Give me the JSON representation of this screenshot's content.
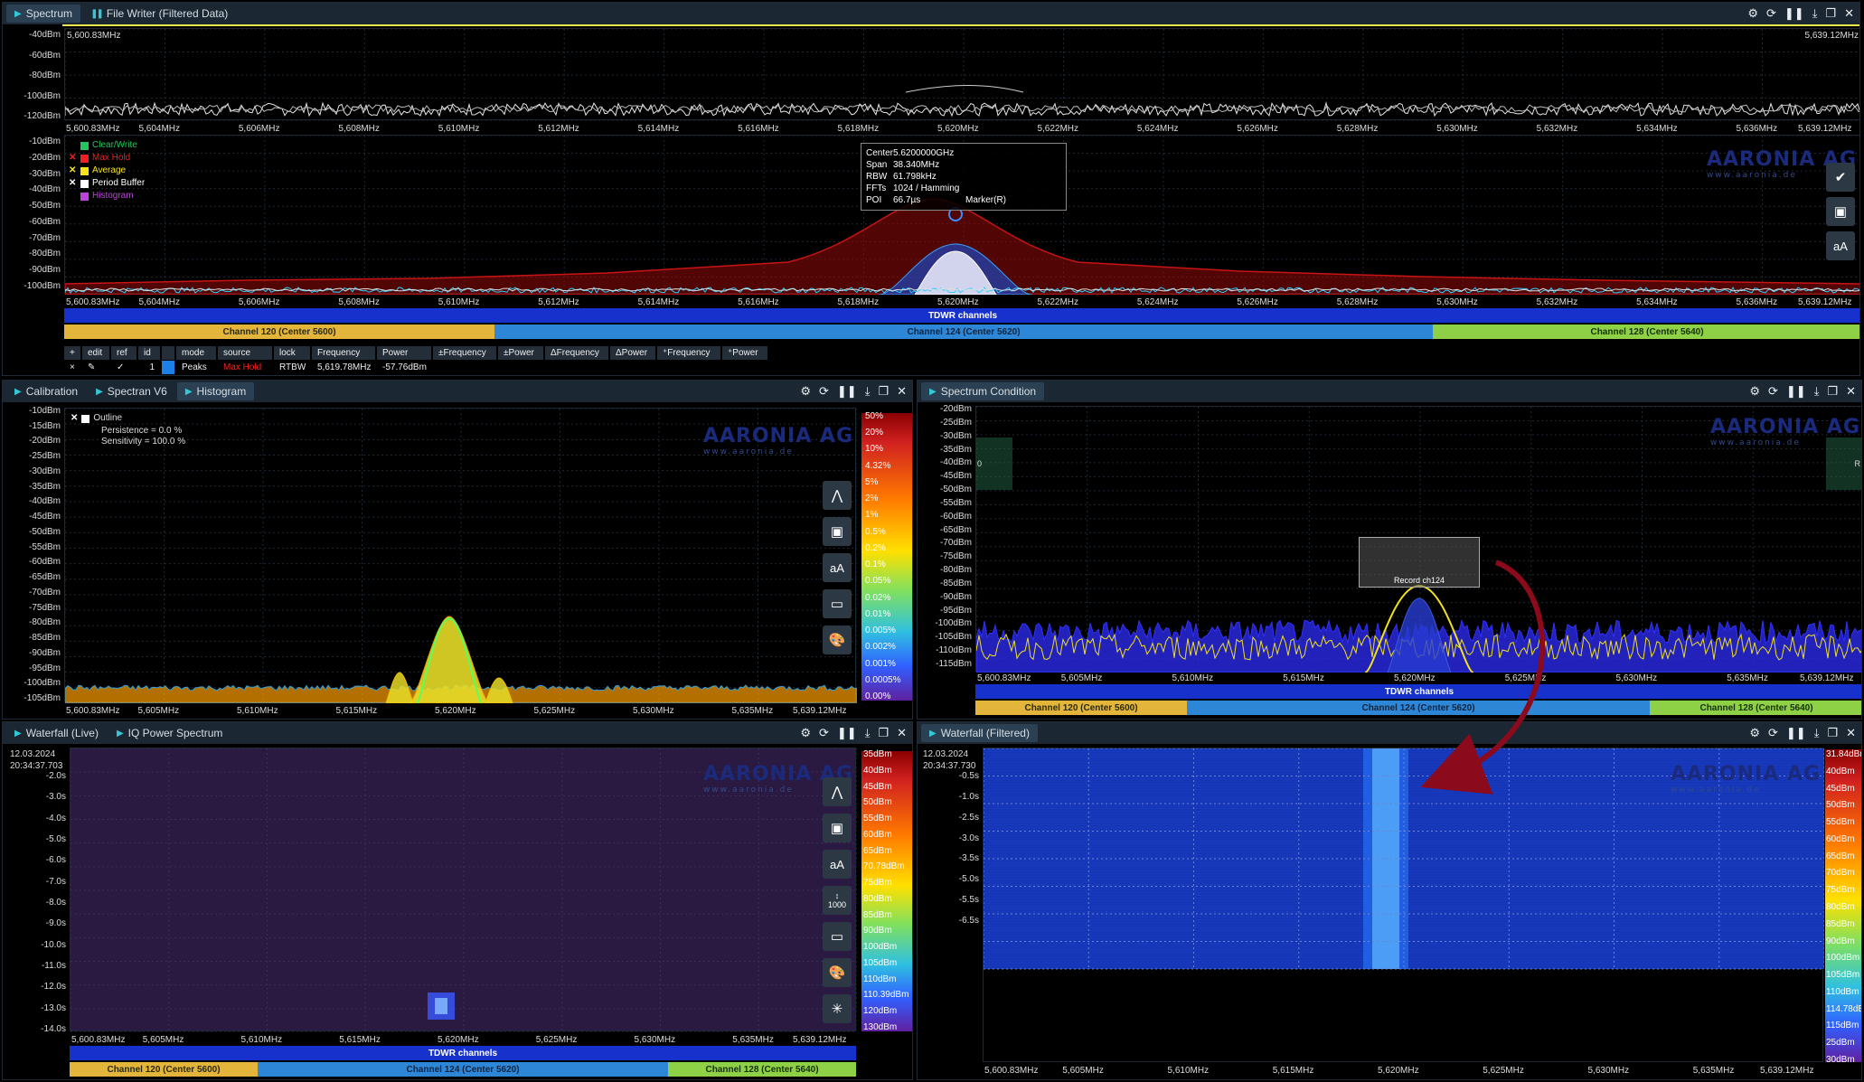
{
  "top": {
    "tabs": [
      {
        "label": "Spectrum"
      },
      {
        "label": "File Writer (Filtered Data)"
      }
    ],
    "overview": {
      "freq_left": "5,600.83MHz",
      "freq_right": "5,639.12MHz",
      "y_labels": [
        "-40dBm",
        "-60dBm",
        "-80dBm",
        "-100dBm",
        "-120dBm"
      ],
      "x_labels": [
        "5,600.83MHz",
        "5,604MHz",
        "5,606MHz",
        "5,608MHz",
        "5,610MHz",
        "5,612MHz",
        "5,614MHz",
        "5,616MHz",
        "5,618MHz",
        "5,620MHz",
        "5,622MHz",
        "5,624MHz",
        "5,626MHz",
        "5,628MHz",
        "5,630MHz",
        "5,632MHz",
        "5,634MHz",
        "5,636MHz",
        "5,639.12MHz"
      ]
    },
    "main": {
      "y_labels": [
        "-10dBm",
        "-20dBm",
        "-30dBm",
        "-40dBm",
        "-50dBm",
        "-60dBm",
        "-70dBm",
        "-80dBm",
        "-90dBm",
        "-100dBm"
      ],
      "x_labels": [
        "5,600.83MHz",
        "5,604MHz",
        "5,606MHz",
        "5,608MHz",
        "5,610MHz",
        "5,612MHz",
        "5,614MHz",
        "5,616MHz",
        "5,618MHz",
        "5,620MHz",
        "5,622MHz",
        "5,624MHz",
        "5,626MHz",
        "5,628MHz",
        "5,630MHz",
        "5,632MHz",
        "5,634MHz",
        "5,636MHz",
        "5,639.12MHz"
      ],
      "legend": [
        {
          "label": "Clear/Write",
          "color": "#22c55e"
        },
        {
          "label": "Max Hold",
          "color": "#ef2020"
        },
        {
          "label": "Average",
          "color": "#f5e21a"
        },
        {
          "label": "Period Buffer",
          "color": "#ffffff"
        },
        {
          "label": "Histogram",
          "color": "#c040e0"
        }
      ],
      "tooltip": {
        "center_k": "Center",
        "center": "5.6200000GHz",
        "span_k": "Span",
        "span": "38.340MHz",
        "rbw_k": "RBW",
        "rbw": "61.798kHz",
        "ffts_k": "FFTs",
        "ffts": "1024 / Hamming",
        "poi_k": "POI",
        "poi": "66.7µs",
        "marker": "Marker(R)"
      }
    },
    "channels": {
      "tdwr": "TDWR channels",
      "ch120": "Channel 120 (Center 5600)",
      "ch124": "Channel 124 (Center 5620)",
      "ch128": "Channel 128 (Center 5640)"
    },
    "marker_table": {
      "headers": [
        "+",
        "edit",
        "ref",
        "id",
        "",
        "mode",
        "source",
        "lock",
        "Frequency",
        "Power",
        "±Frequency",
        "±Power",
        "ΔFrequency",
        "ΔPower",
        "⁺Frequency",
        "⁺Power"
      ],
      "row": {
        "x": "×",
        "edit": "✎",
        "ref": "✓",
        "id": "1",
        "mode": "Peaks",
        "source": "Max Hold",
        "lock": "RTBW",
        "freq": "5,619.78MHz",
        "power": "-57.76dBm"
      }
    },
    "watermark": "AARONIA AG",
    "watermark_sub": "www.aaronia.de"
  },
  "calib": {
    "tabs": [
      {
        "label": "Calibration"
      },
      {
        "label": "Spectran V6"
      },
      {
        "label": "Histogram"
      }
    ],
    "y_labels": [
      "-10dBm",
      "-15dBm",
      "-20dBm",
      "-25dBm",
      "-30dBm",
      "-35dBm",
      "-40dBm",
      "-45dBm",
      "-50dBm",
      "-55dBm",
      "-60dBm",
      "-65dBm",
      "-70dBm",
      "-75dBm",
      "-80dBm",
      "-85dBm",
      "-90dBm",
      "-95dBm",
      "-100dBm",
      "-105dBm"
    ],
    "x_labels": [
      "5,600.83MHz",
      "5,605MHz",
      "5,610MHz",
      "5,615MHz",
      "5,620MHz",
      "5,625MHz",
      "5,630MHz",
      "5,635MHz",
      "5,639.12MHz"
    ],
    "outline": "Outline",
    "persistence": "Persistence = 0.0 %",
    "sensitivity": "Sensitivity = 100.0 %",
    "scale": [
      "50%",
      "20%",
      "10%",
      "4.32%",
      "5%",
      "2%",
      "1%",
      "0.5%",
      "0.2%",
      "0.1%",
      "0.05%",
      "0.02%",
      "0.01%",
      "0.005%",
      "0.002%",
      "0.001%",
      "0.0005%",
      "0.00%"
    ]
  },
  "cond": {
    "tabs": [
      {
        "label": "Spectrum Condition"
      }
    ],
    "y_labels": [
      "-20dBm",
      "-25dBm",
      "-30dBm",
      "-35dBm",
      "-40dBm",
      "-45dBm",
      "-50dBm",
      "-55dBm",
      "-60dBm",
      "-65dBm",
      "-70dBm",
      "-75dBm",
      "-80dBm",
      "-85dBm",
      "-90dBm",
      "-95dBm",
      "-100dBm",
      "-105dBm",
      "-110dBm",
      "-115dBm"
    ],
    "x_labels": [
      "5,600.83MHz",
      "5,605MHz",
      "5,610MHz",
      "5,615MHz",
      "5,620MHz",
      "5,625MHz",
      "5,630MHz",
      "5,635MHz",
      "5,639.12MHz"
    ],
    "record_label": "Record ch124",
    "left_marker": "0",
    "right_marker": "R"
  },
  "wf_live": {
    "tabs": [
      {
        "label": "Waterfall (Live)"
      },
      {
        "label": "IQ Power Spectrum"
      }
    ],
    "date": "12.03.2024",
    "time": "20:34:37.703",
    "y_labels": [
      "-2.0s",
      "-3.0s",
      "-4.0s",
      "-5.0s",
      "-6.0s",
      "-7.0s",
      "-8.0s",
      "-9.0s",
      "-10.0s",
      "-11.0s",
      "-12.0s",
      "-13.0s",
      "-14.0s"
    ],
    "x_labels": [
      "5,600.83MHz",
      "5,605MHz",
      "5,610MHz",
      "5,615MHz",
      "5,620MHz",
      "5,625MHz",
      "5,630MHz",
      "5,635MHz",
      "5,639.12MHz"
    ],
    "scale": [
      "35dBm",
      "40dBm",
      "45dBm",
      "50dBm",
      "55dBm",
      "60dBm",
      "65dBm",
      "70.78dBm",
      "75dBm",
      "80dBm",
      "85dBm",
      "90dBm",
      "100dBm",
      "105dBm",
      "110dBm",
      "110.39dBm",
      "120dBm",
      "130dBm"
    ],
    "ticks_label": "1000"
  },
  "wf_filt": {
    "tabs": [
      {
        "label": "Waterfall (Filtered)"
      }
    ],
    "date": "12.03.2024",
    "time": "20:34:37.730",
    "y_labels": [
      "-0.5s",
      "-1.0s",
      "-2.5s",
      "-3.0s",
      "-3.5s",
      "-5.0s",
      "-5.5s",
      "-6.5s"
    ],
    "x_labels": [
      "5,600.83MHz",
      "5,605MHz",
      "5,610MHz",
      "5,615MHz",
      "5,620MHz",
      "5,625MHz",
      "5,630MHz",
      "5,635MHz",
      "5,639.12MHz"
    ],
    "scale": [
      "31.84dBm",
      "40dBm",
      "45dBm",
      "50dBm",
      "55dBm",
      "60dBm",
      "65dBm",
      "70dBm",
      "75dBm",
      "80dBm",
      "85dBm",
      "90dBm",
      "100dBm",
      "105dBm",
      "110dBm",
      "114.78dBm",
      "115dBm",
      "25dBm",
      "30dBm"
    ]
  },
  "colors": {
    "accent": "#33c7d8",
    "tdwr": "#1732cc",
    "ch120": "#e3b53a",
    "ch124": "#2e86d6",
    "ch128": "#8fd146"
  }
}
